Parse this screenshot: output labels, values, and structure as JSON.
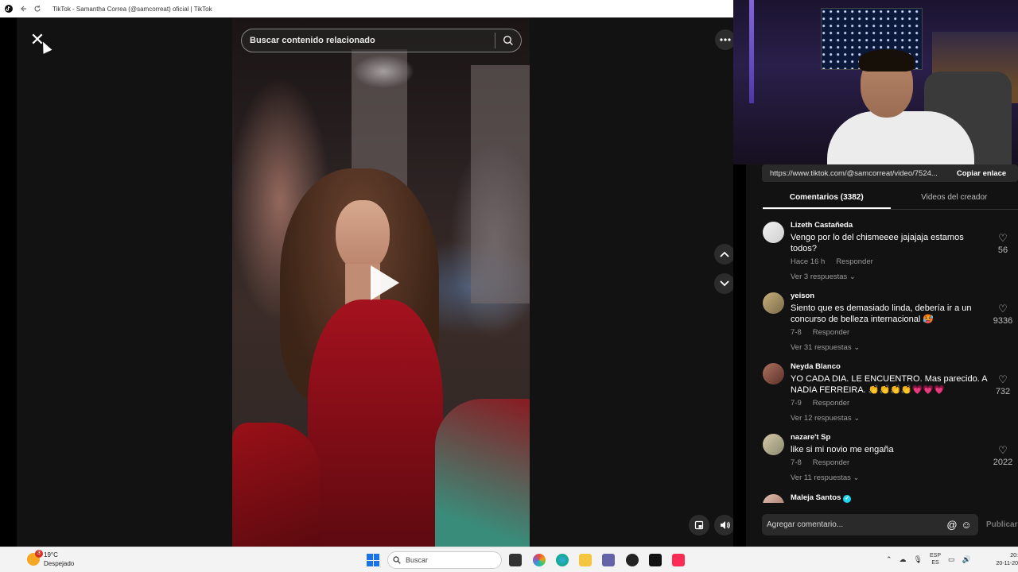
{
  "window": {
    "title": "TikTok - Samantha Correa (@samcorreat) oficial | TikTok"
  },
  "video": {
    "search_placeholder": "Buscar contenido relacionado"
  },
  "panel": {
    "url": "https://www.tiktok.com/@samcorreat/video/7524...",
    "copy_label": "Copiar enlace",
    "tabs": [
      {
        "label": "Comentarios (3382)",
        "active": true
      },
      {
        "label": "Videos del creador",
        "active": false
      }
    ],
    "comments": [
      {
        "author": "Lizeth Castañeda",
        "text": "Vengo por lo del chismeeee jajajaja estamos todos?",
        "time": "Hace 16 h",
        "reply": "Responder",
        "view_replies": "Ver 3 respuestas ⌄",
        "likes": "56"
      },
      {
        "author": "yeison",
        "text": "Siento que es demasiado linda, debería ir a un concurso de belleza internacional 🥵",
        "time": "7-8",
        "reply": "Responder",
        "view_replies": "Ver 31 respuestas ⌄",
        "likes": "9336"
      },
      {
        "author": "Neyda Blanco",
        "text": "YO CADA DIA. LE ENCUENTRO. Mas parecido. A NADIA FERREIRA. 👏👏👏👏💗💗💗",
        "time": "7-9",
        "reply": "Responder",
        "view_replies": "Ver 12 respuestas ⌄",
        "likes": "732"
      },
      {
        "author": "nazare't Sp",
        "text": "like si mi novio me engaña",
        "time": "7-8",
        "reply": "Responder",
        "view_replies": "Ver 11 respuestas ⌄",
        "likes": "2022"
      },
      {
        "author": "Maleja Santos",
        "text": "",
        "time": "",
        "reply": "",
        "view_replies": "",
        "likes": ""
      }
    ],
    "comment_placeholder": "Agregar comentario...",
    "publish_label": "Publicar"
  },
  "taskbar": {
    "weather_badge": "3",
    "temperature": "19°C",
    "condition": "Despejado",
    "search_placeholder": "Buscar",
    "lang_top": "ESP",
    "lang_bottom": "ES",
    "clock_time": "20:",
    "clock_date": "20-11-20"
  },
  "colors": {
    "accent": "#fe2c55",
    "verified": "#20d5ec"
  }
}
